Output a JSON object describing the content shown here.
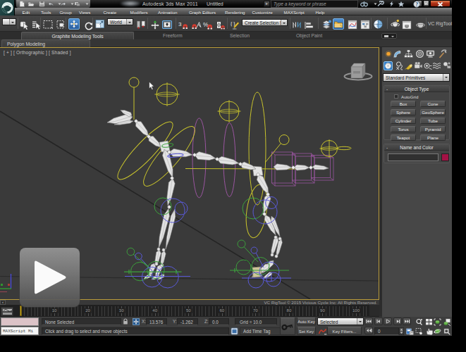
{
  "title": {
    "app": "Autodesk 3ds Max 2011",
    "doc": "Untitled"
  },
  "search": {
    "placeholder": "Type a keyword or phrase"
  },
  "menus": [
    "Edit",
    "Tools",
    "Group",
    "Views",
    "Create",
    "Modifiers",
    "Animation",
    "Graph Editors",
    "Rendering",
    "Customize",
    "MAXScript",
    "Help"
  ],
  "toolbar": {
    "world_combo": "World",
    "selection_set_combo": "Create Selection Se",
    "rigtool_label": "VC RigTool",
    "snap_3d_label": "3"
  },
  "ribbon": {
    "tabs": [
      "Graphite Modeling Tools",
      "Freeform",
      "Selection",
      "Object Paint"
    ],
    "panel_tab": "Polygon Modeling"
  },
  "viewport": {
    "label": "[ + ] [ Orthographic ] [ Shaded ]",
    "watermark": "VC RigTool © 2015 Vicious Cycle Inc: All Rights Reserved."
  },
  "command_panel": {
    "dropdown": "Standard Primitives",
    "object_type": {
      "title": "Object Type",
      "autogrid": "AutoGrid",
      "buttons": [
        "Box",
        "Cone",
        "Sphere",
        "GeoSphere",
        "Cylinder",
        "Tube",
        "Torus",
        "Pyramid",
        "Teapot",
        "Plane"
      ]
    },
    "name_color": {
      "title": "Name and Color",
      "name_value": ""
    }
  },
  "timeline": {
    "numbers": [
      10,
      20,
      30,
      40,
      50,
      60,
      70,
      80,
      90,
      100
    ],
    "frame_current": "0"
  },
  "colors": {
    "viewport_border": "#ba9c3a",
    "object_color_swatch": "#a41245",
    "active_tool_highlight": "#4f8fd0",
    "frame_marker": "#c8a61e",
    "close_button": "#b03318",
    "maxscript_field_pink": "#dcc3c7"
  },
  "status": {
    "maxscript_text": "MAXScript Mi",
    "selection": "None Selected",
    "x_label": "X:",
    "x_value": "13.576",
    "y_label": "Y:",
    "y_value": "-1.262",
    "z_label": "Z:",
    "z_value": "0.0",
    "grid": "Grid = 10.0",
    "prompt": "Click and drag to select and move objects",
    "add_time_tag": "Add Time Tag",
    "auto_key": "Auto Key",
    "set_key": "Set Key",
    "key_mode_combo": "Selected",
    "key_filters": "Key Filters...",
    "frame_field": "0"
  }
}
